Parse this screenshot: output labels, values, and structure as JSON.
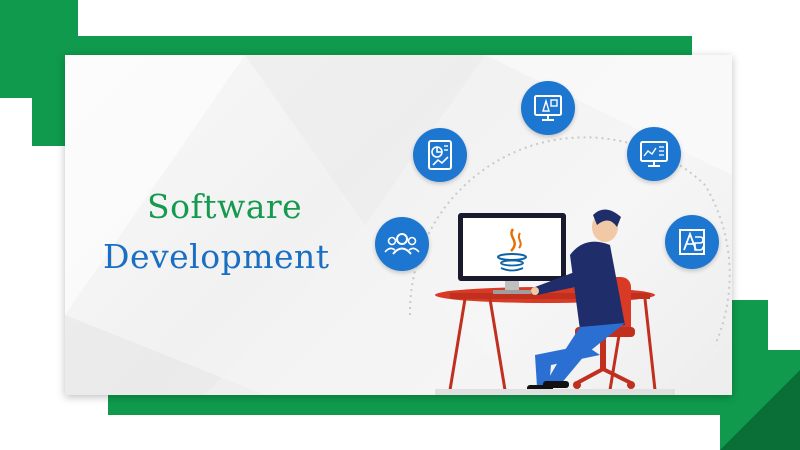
{
  "title": {
    "line1": "Software",
    "line2": "Development"
  },
  "icons": [
    "team-icon",
    "report-chart-icon",
    "design-monitor-icon",
    "analytics-monitor-icon",
    "typography-icon"
  ],
  "colors": {
    "frame_green": "#0f9a4d",
    "frame_dark_green": "#0a6e37",
    "title_green": "#159a4f",
    "title_blue": "#1a6fc4",
    "icon_blue": "#1d77d1",
    "desk_red": "#d93a26",
    "person_navy": "#1f2e6b",
    "person_pants": "#2a6fd1",
    "java_orange": "#e76f00",
    "java_blue": "#0c63a8"
  }
}
